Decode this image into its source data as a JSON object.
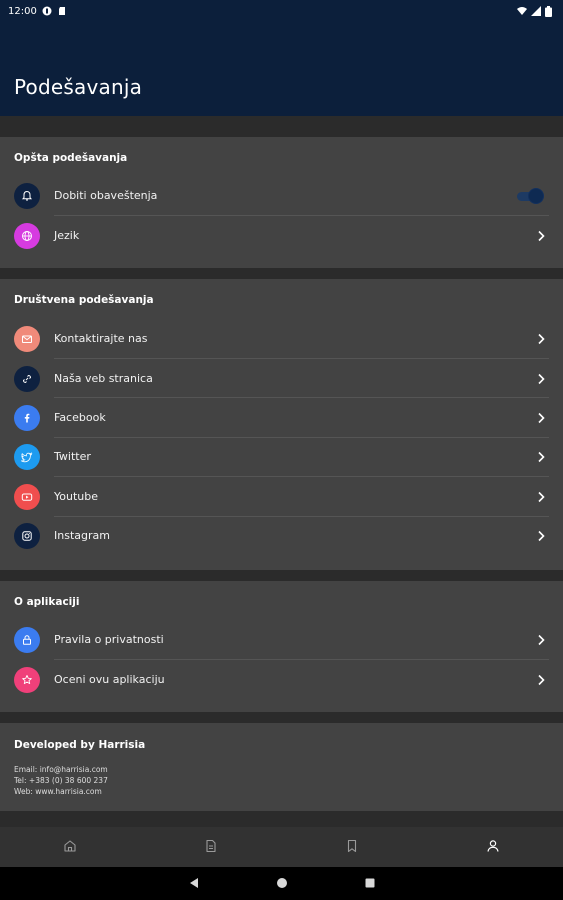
{
  "status": {
    "time": "12:00"
  },
  "header": {
    "title": "Podešavanja"
  },
  "general": {
    "title": "Opšta podešavanja",
    "items": [
      {
        "label": "Dobiti obaveštenja",
        "icon": "bell-icon",
        "color": "#0e2140",
        "toggle": true
      },
      {
        "label": "Jezik",
        "icon": "globe-icon",
        "color": "#d63be0"
      }
    ]
  },
  "social": {
    "title": "Društvena podešavanja",
    "items": [
      {
        "label": "Kontaktirajte nas",
        "icon": "mail-icon",
        "color": "#f08a7a"
      },
      {
        "label": "Naša veb stranica",
        "icon": "link-icon",
        "color": "#0e2140"
      },
      {
        "label": "Facebook",
        "icon": "facebook-icon",
        "color": "#3b7cf0"
      },
      {
        "label": "Twitter",
        "icon": "twitter-icon",
        "color": "#1d9bf0"
      },
      {
        "label": "Youtube",
        "icon": "youtube-icon",
        "color": "#f04e4e"
      },
      {
        "label": "Instagram",
        "icon": "instagram-icon",
        "color": "#0e2140"
      }
    ]
  },
  "about": {
    "title": "O aplikaciji",
    "items": [
      {
        "label": "Pravila o privatnosti",
        "icon": "lock-icon",
        "color": "#3b7cf0"
      },
      {
        "label": "Oceni ovu aplikaciju",
        "icon": "star-icon",
        "color": "#f0407a"
      }
    ]
  },
  "developer": {
    "title": "Developed by Harrisia",
    "email": "Email: info@harrisia.com",
    "tel": "Tel: +383 (0) 38 600 237",
    "web": "Web: www.harrisia.com"
  },
  "bottom_nav": [
    "home-icon",
    "document-icon",
    "bookmark-icon",
    "person-icon"
  ],
  "colors": {
    "header_bg": "#0c1f3b",
    "card_bg": "#434343",
    "page_bg": "#2b2b2b"
  }
}
